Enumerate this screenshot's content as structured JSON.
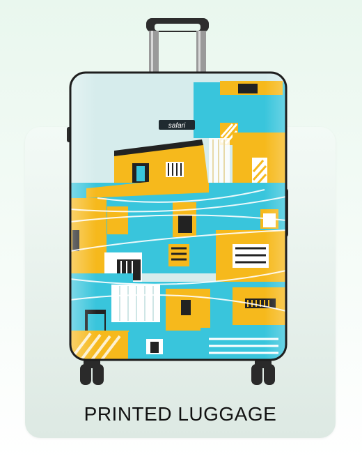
{
  "product": {
    "brand": "safari",
    "caption": "PRINTED LUGGAGE"
  },
  "colors": {
    "cyan": "#36c8dd",
    "yellow": "#f6b91c",
    "card_bg": "#e6f0eb"
  }
}
